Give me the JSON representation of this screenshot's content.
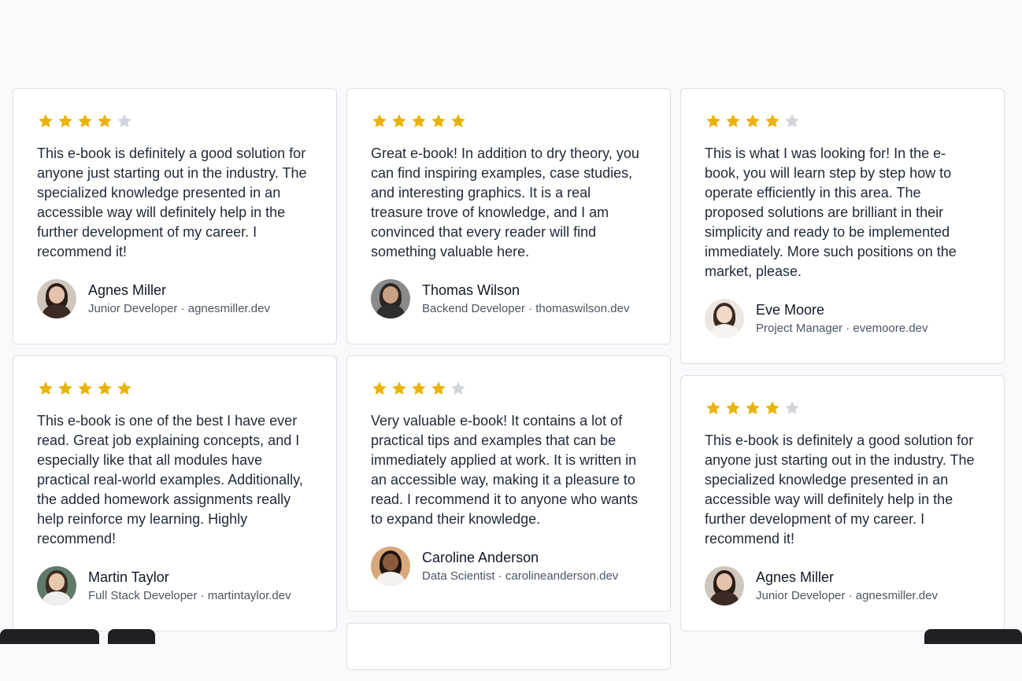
{
  "colors": {
    "star_filled": "#eab308",
    "star_empty": "#d1d5db"
  },
  "columns": [
    [
      {
        "rating": 4,
        "text": "This e-book is definitely a good solution for anyone just starting out in the industry. The specialized knowledge presented in an accessible way will definitely help in the further development of my career. I recommend it!",
        "name": "Agnes Miller",
        "role": "Junior Developer · agnesmiller.dev",
        "avatar": {
          "bg": "#cfc7bd",
          "hair": "#2a1d16",
          "skin": "#e4c3aa",
          "shirt": "#3a2c25"
        }
      },
      {
        "rating": 5,
        "text": "This e-book is one of the best I have ever read. Great job explaining concepts, and I especially like that all modules have practical real-world examples. Additionally, the added homework assignments really help reinforce my learning. Highly recommend!",
        "name": "Martin Taylor",
        "role": "Full Stack Developer · martintaylor.dev",
        "avatar": {
          "bg": "#5f7a6a",
          "hair": "#3b2b20",
          "skin": "#e8c9ae",
          "shirt": "#eeeeee"
        }
      }
    ],
    [
      {
        "rating": 5,
        "text": "Great e-book! In addition to dry theory, you can find inspiring examples, case studies, and interesting graphics. It is a real treasure trove of knowledge, and I am convinced that every reader will find something valuable here.",
        "name": "Thomas Wilson",
        "role": "Backend Developer · thomaswilson.dev",
        "avatar": {
          "bg": "#8a8a8a",
          "hair": "#2b2522",
          "skin": "#c9a184",
          "shirt": "#2f2f2f"
        }
      },
      {
        "rating": 4,
        "text": "Very valuable e-book! It contains a lot of practical tips and examples that can be immediately applied at work. It is written in an accessible way, making it a pleasure to read. I recommend it to anyone who wants to expand their knowledge.",
        "name": "Caroline Anderson",
        "role": "Data Scientist · carolineanderson.dev",
        "avatar": {
          "bg": "#d9a87a",
          "hair": "#1e1512",
          "skin": "#8a5a3d",
          "shirt": "#f4f1ec"
        }
      }
    ],
    [
      {
        "rating": 4,
        "text": "This is what I was looking for! In the e-book, you will learn step by step how to operate efficiently in this area. The proposed solutions are brilliant in their simplicity and ready to be implemented immediately. More such positions on the market, please.",
        "name": "Eve Moore",
        "role": "Project Manager · evemoore.dev",
        "avatar": {
          "bg": "#ece7e0",
          "hair": "#3a2a22",
          "skin": "#efd8c6",
          "shirt": "#f7f4ef"
        }
      },
      {
        "rating": 4,
        "text": "This e-book is definitely a good solution for anyone just starting out in the industry. The specialized knowledge presented in an accessible way will definitely help in the further development of my career. I recommend it!",
        "name": "Agnes Miller",
        "role": "Junior Developer · agnesmiller.dev",
        "avatar": {
          "bg": "#cfc7bd",
          "hair": "#2a1d16",
          "skin": "#e4c3aa",
          "shirt": "#3a2c25"
        }
      }
    ]
  ]
}
